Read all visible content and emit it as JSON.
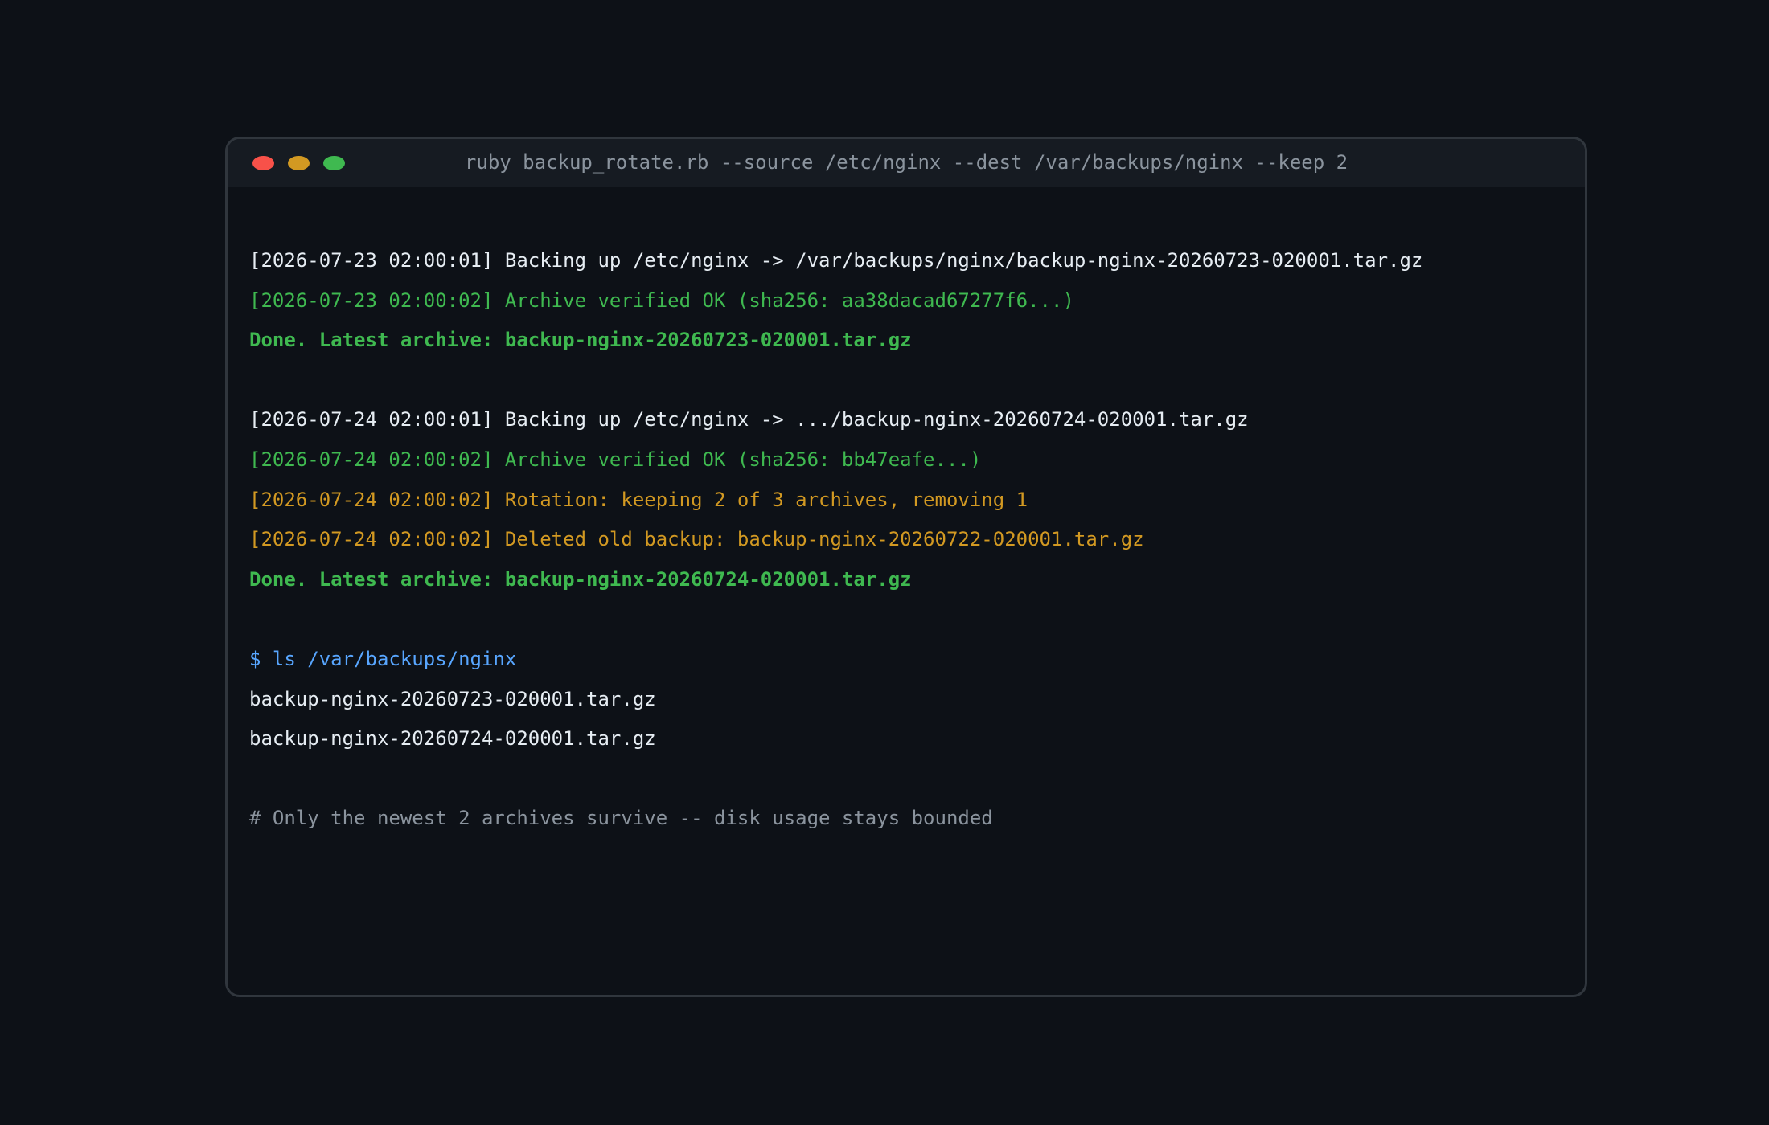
{
  "window": {
    "title": "ruby backup_rotate.rb --source /etc/nginx --dest /var/backups/nginx --keep 2",
    "controls": [
      "close",
      "minimize",
      "maximize"
    ]
  },
  "colors": {
    "background": "#0d1117",
    "titlebar": "#161b22",
    "text": "#e6edf3",
    "success": "#3fb950",
    "warning": "#d29922",
    "prompt": "#58a6ff",
    "comment": "#8b949e"
  },
  "output": {
    "run1": {
      "backup_line": "[2026-07-23 02:00:01] Backing up /etc/nginx -> /var/backups/nginx/backup-nginx-20260723-020001.tar.gz",
      "verify_line": "[2026-07-23 02:00:02] Archive verified OK (sha256: aa38dacad67277f6...)",
      "done_line": "Done. Latest archive: backup-nginx-20260723-020001.tar.gz"
    },
    "run2": {
      "backup_line": "[2026-07-24 02:00:01] Backing up /etc/nginx -> .../backup-nginx-20260724-020001.tar.gz",
      "verify_line": "[2026-07-24 02:00:02] Archive verified OK (sha256: bb47eafe...)",
      "rotation_line": "[2026-07-24 02:00:02] Rotation: keeping 2 of 3 archives, removing 1",
      "deleted_line": "[2026-07-24 02:00:02] Deleted old backup: backup-nginx-20260722-020001.tar.gz",
      "done_line": "Done. Latest archive: backup-nginx-20260724-020001.tar.gz"
    },
    "ls": {
      "command": "$ ls /var/backups/nginx",
      "files": [
        "backup-nginx-20260723-020001.tar.gz",
        "backup-nginx-20260724-020001.tar.gz"
      ]
    },
    "comment": "# Only the newest 2 archives survive -- disk usage stays bounded"
  }
}
